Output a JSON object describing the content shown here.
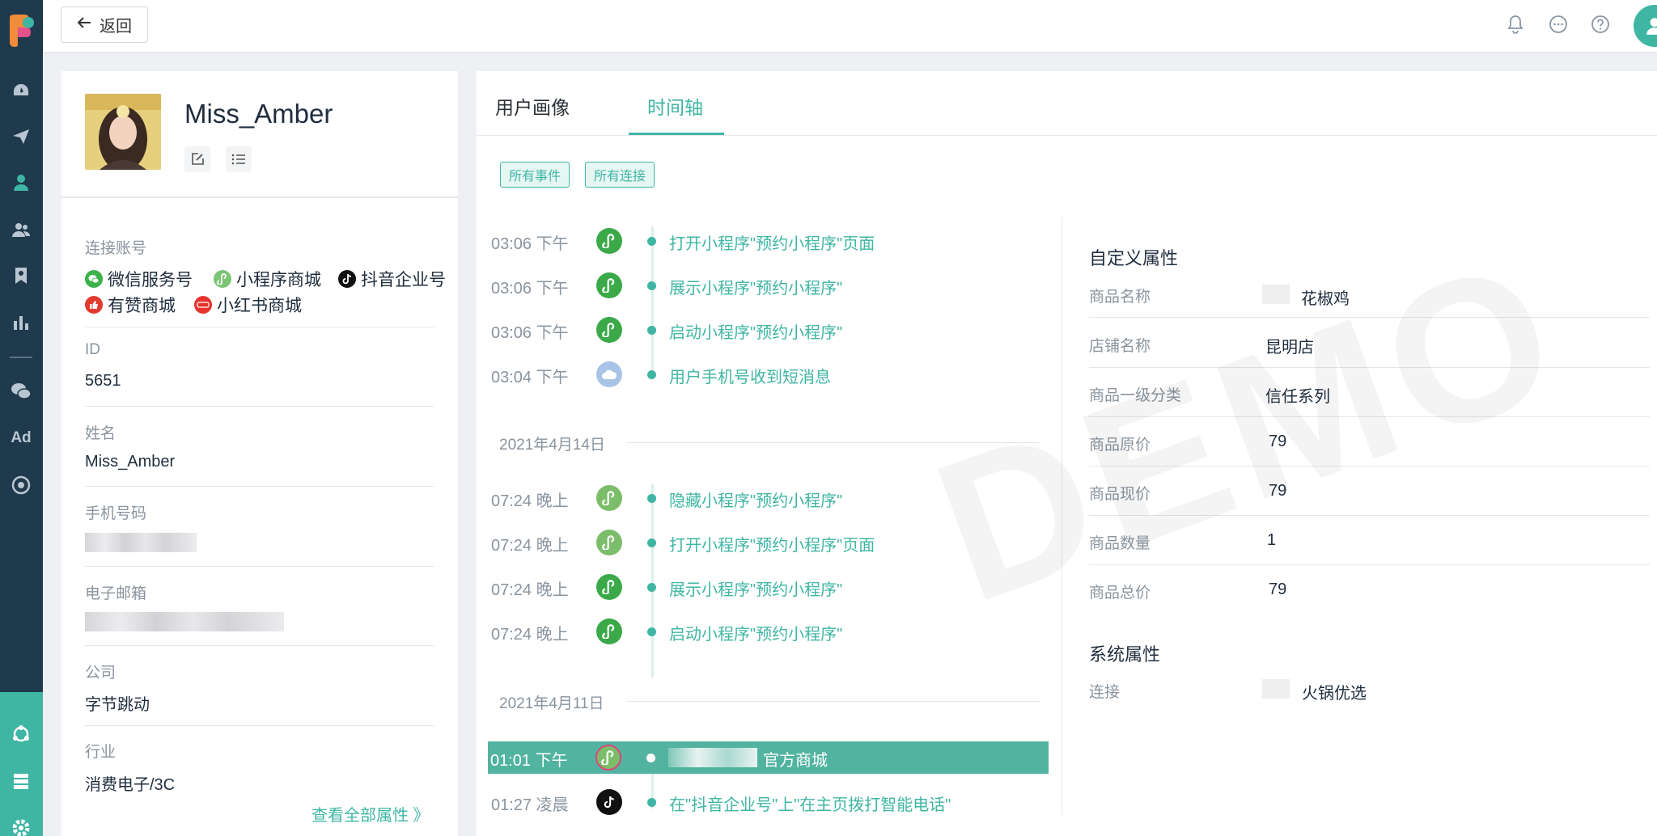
{
  "topbar": {
    "back_label": "返回"
  },
  "profile": {
    "name": "Miss_Amber",
    "accounts_label": "连接账号",
    "accounts": [
      {
        "name": "微信服务号",
        "color": "#3cb34a"
      },
      {
        "name": "小程序商城",
        "color": "#7cc576"
      },
      {
        "name": "抖音企业号",
        "color": "#111111"
      },
      {
        "name": "有赞商城",
        "color": "#e23b2e"
      },
      {
        "name": "小红书商城",
        "color": "#e8342f"
      }
    ],
    "fields": [
      {
        "label": "ID",
        "value": "5651"
      },
      {
        "label": "姓名",
        "value": "Miss_Amber"
      },
      {
        "label": "手机号码",
        "value": ""
      },
      {
        "label": "电子邮箱",
        "value": ""
      },
      {
        "label": "公司",
        "value": "字节跳动"
      },
      {
        "label": "行业",
        "value": "消费电子/3C"
      }
    ],
    "view_all": "查看全部属性 》"
  },
  "tabs": [
    {
      "label": "用户画像",
      "active": false
    },
    {
      "label": "时间轴",
      "active": true
    }
  ],
  "filters": [
    "所有事件",
    "所有连接"
  ],
  "timeline": {
    "group1": [
      {
        "time": "03:06 下午",
        "text": "打开小程序\"预约小程序\"页面",
        "icon": "mini-program-icon"
      },
      {
        "time": "03:06 下午",
        "text": "展示小程序\"预约小程序\"",
        "icon": "mini-program-icon"
      },
      {
        "time": "03:06 下午",
        "text": "启动小程序\"预约小程序\"",
        "icon": "mini-program-icon"
      },
      {
        "time": "03:04 下午",
        "text": "用户手机号收到短消息",
        "icon": "cloud-icon"
      }
    ],
    "date2": "2021年4月14日",
    "group2": [
      {
        "time": "07:24 晚上",
        "text": "隐藏小程序\"预约小程序\"",
        "icon": "mini-program-icon"
      },
      {
        "time": "07:24 晚上",
        "text": "打开小程序\"预约小程序\"页面",
        "icon": "mini-program-icon"
      },
      {
        "time": "07:24 晚上",
        "text": "展示小程序\"预约小程序\"",
        "icon": "mini-program-icon"
      },
      {
        "time": "07:24 晚上",
        "text": "启动小程序\"预约小程序\"",
        "icon": "mini-program-icon"
      }
    ],
    "date3": "2021年4月11日",
    "group3": [
      {
        "time": "01:01 下午",
        "text": "官方商城",
        "icon": "mini-program-icon",
        "highlight": true
      },
      {
        "time": "01:27 凌晨",
        "text": "在\"抖音企业号\"上\"在主页拨打智能电话\"",
        "icon": "douyin-icon"
      }
    ]
  },
  "custom_attrs": {
    "heading": "自定义属性",
    "items": [
      {
        "key": "商品名称",
        "value": "花椒鸡"
      },
      {
        "key": "店铺名称",
        "value": "昆明店"
      },
      {
        "key": "商品一级分类",
        "value": "信任系列"
      },
      {
        "key": "商品原价",
        "value": "79"
      },
      {
        "key": "商品现价",
        "value": "79"
      },
      {
        "key": "商品数量",
        "value": "1"
      },
      {
        "key": "商品总价",
        "value": "79"
      }
    ]
  },
  "system_attrs": {
    "heading": "系统属性",
    "items": [
      {
        "key": "连接",
        "value": "火锅优选"
      }
    ]
  },
  "watermark": "DEMO",
  "colors": {
    "accent": "#3fb6a4",
    "rail": "#1f3a4d",
    "highlight_row": "#52b3a1"
  }
}
